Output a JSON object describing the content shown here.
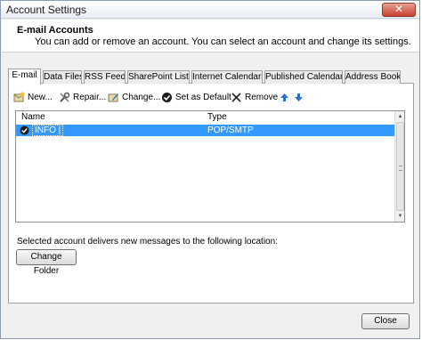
{
  "window": {
    "title": "Account Settings",
    "close_glyph": "✕"
  },
  "header": {
    "title": "E-mail Accounts",
    "description": "You can add or remove an account. You can select an account and change its settings."
  },
  "tabs": [
    {
      "label": "E-mail",
      "active": true
    },
    {
      "label": "Data Files",
      "active": false
    },
    {
      "label": "RSS Feeds",
      "active": false
    },
    {
      "label": "SharePoint Lists",
      "active": false
    },
    {
      "label": "Internet Calendars",
      "active": false
    },
    {
      "label": "Published Calendars",
      "active": false
    },
    {
      "label": "Address Books",
      "active": false
    }
  ],
  "toolbar": {
    "new_label": "New...",
    "repair_label": "Repair...",
    "change_label": "Change...",
    "default_label": "Set as Default",
    "remove_label": "Remove"
  },
  "accounts": {
    "columns": {
      "name": "Name",
      "type": "Type"
    },
    "rows": [
      {
        "name": "INFO |",
        "type": "POP/SMTP",
        "selected": true,
        "is_default": true
      }
    ]
  },
  "delivery": {
    "text": "Selected account delivers new messages to the following location:",
    "change_folder_label": "Change Folder"
  },
  "footer": {
    "close_label": "Close"
  },
  "colors": {
    "selection": "#3399ff",
    "arrow_blue": "#2f6fd1"
  }
}
